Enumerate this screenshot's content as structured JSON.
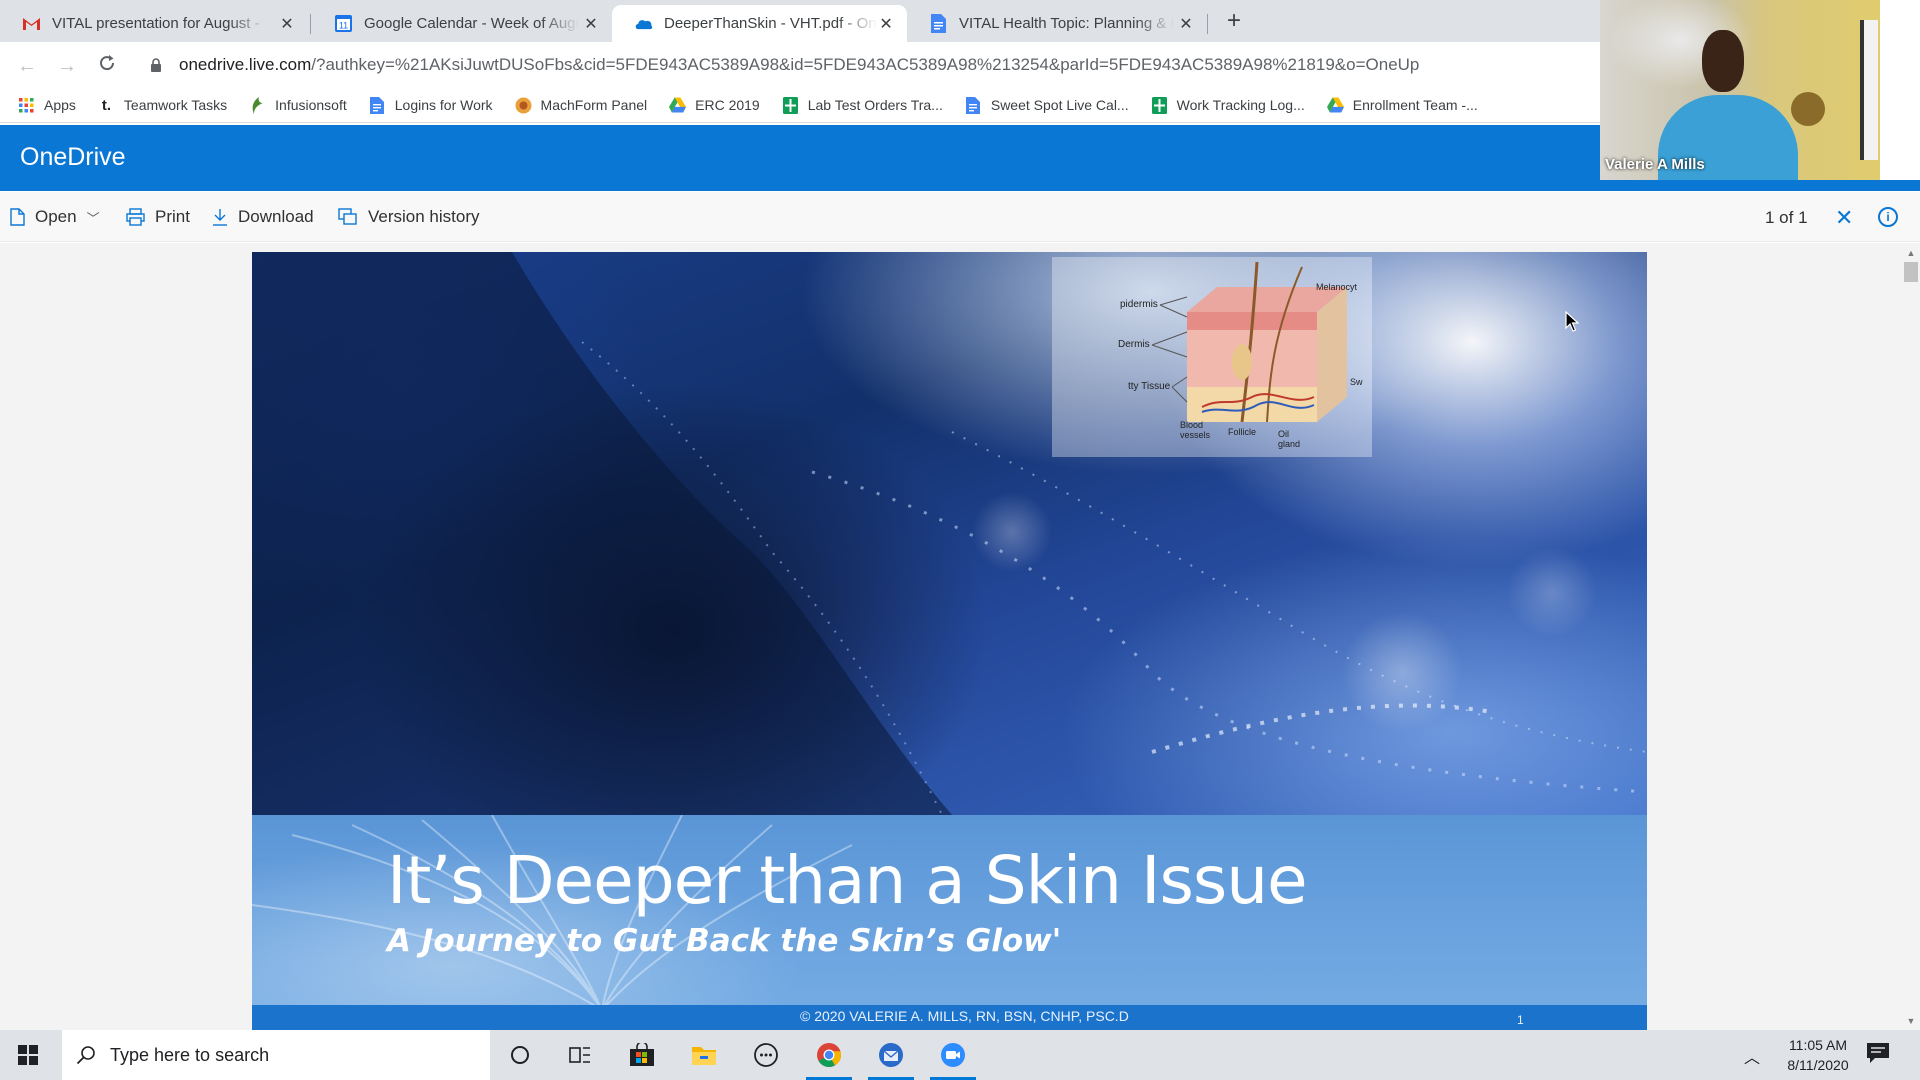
{
  "browser": {
    "tabs": [
      {
        "title": "VITAL presentation for August - ",
        "favicon": "gmail-icon",
        "active": false
      },
      {
        "title": "Google Calendar - Week of Augu",
        "favicon": "calendar-icon",
        "active": false
      },
      {
        "title": "DeeperThanSkin - VHT.pdf - One",
        "favicon": "onedrive-icon",
        "active": true
      },
      {
        "title": "VITAL Health Topic: Planning & E",
        "favicon": "docs-icon",
        "active": false
      }
    ],
    "calendar_day": "11",
    "url_host": "onedrive.live.com",
    "url_path": "/?authkey=%21AKsiJuwtDUSoFbs&cid=5FDE943AC5389A98&id=5FDE943AC5389A98%213254&parId=5FDE943AC5389A98%21819&o=OneUp",
    "bookmarks": [
      {
        "label": "Apps",
        "icon": "apps-grid-icon"
      },
      {
        "label": "Teamwork Tasks",
        "icon": "teamwork-icon"
      },
      {
        "label": "Infusionsoft",
        "icon": "infusionsoft-icon"
      },
      {
        "label": "Logins for Work",
        "icon": "docs-icon"
      },
      {
        "label": "MachForm Panel",
        "icon": "machform-icon"
      },
      {
        "label": "ERC 2019",
        "icon": "drive-icon"
      },
      {
        "label": "Lab Test Orders Tra...",
        "icon": "sheets-icon"
      },
      {
        "label": "Sweet Spot Live Cal...",
        "icon": "docs-icon"
      },
      {
        "label": "Work Tracking Log...",
        "icon": "sheets-icon"
      },
      {
        "label": "Enrollment Team -...",
        "icon": "drive-icon"
      }
    ]
  },
  "onedrive": {
    "brand": "OneDrive",
    "commands": {
      "open": "Open",
      "print": "Print",
      "download": "Download",
      "version_history": "Version history"
    },
    "pager": "1 of 1"
  },
  "slide": {
    "title": "It’s Deeper than a Skin Issue",
    "subtitle": "A Journey to Gut Back the Skin’s Glow'",
    "copyright": "© 2020  VALERIE A. MILLS, RN, BSN, CNHP, PSC.D",
    "page_number": "1",
    "diagram_labels": {
      "epidermis": "pidermis",
      "dermis": "Dermis",
      "fatty_tissue": "tty Tissue",
      "blood_vessels": "Blood vessels",
      "follicle": "Follicle",
      "oil_gland": "Oil gland",
      "melanocyte": "Melanocyt",
      "sweat": "Sw"
    }
  },
  "video": {
    "participant_name": "Valerie A Mills"
  },
  "taskbar": {
    "search_placeholder": "Type here to search",
    "time": "11:05 AM",
    "date": "8/11/2020"
  },
  "colors": {
    "onedrive_blue": "#0a77d4",
    "slide_band": "#6aa3df",
    "slide_footer": "#1c73cc",
    "taskbar": "#dfe3e8"
  }
}
